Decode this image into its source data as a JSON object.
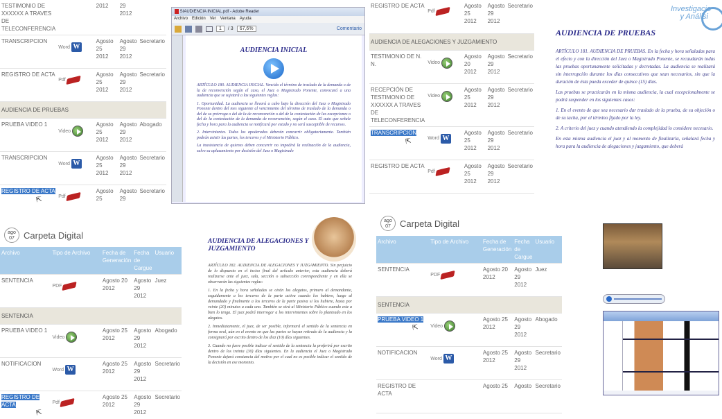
{
  "panel1": {
    "rows": [
      {
        "type": "row",
        "name": "TESTIMONIO DE XXXXXX A TRAVES DE TELECONFERENCIA",
        "file": "",
        "date": "2012",
        "day": "29\n2012",
        "user": ""
      },
      {
        "type": "row",
        "name": "TRANSCRIPCION",
        "file": "Word",
        "date": "Agosto 25\n2012",
        "day": "Agosto\n29\n2012",
        "user": "Secretario"
      },
      {
        "type": "row",
        "name": "REGISTRO DE ACTA",
        "file": "Pdf",
        "date": "Agosto 25\n2012",
        "day": "Agosto\n29\n2012",
        "user": "Secretario"
      },
      {
        "type": "sec",
        "name": "AUDIENCIA DE PRUEBAS"
      },
      {
        "type": "row",
        "name": "PRUEBA VIDEO 1",
        "file": "Video",
        "date": "Agosto 25\n2012",
        "day": "Agosto\n29\n2012",
        "user": "Abogado"
      },
      {
        "type": "row",
        "name": "TRANSCRIPCION",
        "file": "Word",
        "date": "Agosto 25\n2012",
        "day": "Agosto\n29\n2012",
        "user": "Secretario"
      },
      {
        "type": "row",
        "name": "REGISTRO DE ACTA",
        "file": "Pdf",
        "date": "Agosto 25\n2012",
        "day": "Agosto\n29\n2012",
        "user": "Secretario",
        "hl": true
      }
    ]
  },
  "reader": {
    "title": "SIAUDIENCIA INICIAL.pdf - Adobe Reader",
    "menu": [
      "Archivo",
      "Edición",
      "Ver",
      "Ventana",
      "Ayuda"
    ],
    "page": "1",
    "pages": "/ 3",
    "zoom": "67,6%",
    "comment": "Comentario",
    "doc_title": "AUDIENCIA INICIAL",
    "paras": [
      "ARTÍCULO 180. AUDIENCIA INICIAL. Vencido el término de traslado de la demanda o de la de reconvención según el caso, el Juez o Magistrado Ponente, convocará a una audiencia que se sujetará a las siguientes reglas:",
      "1. Oportunidad. La audiencia se llevará a cabo bajo la dirección del Juez o Magistrado Ponente dentro del mes siguiente al vencimiento del término de traslado de la demanda o del de su prórroga o del de la de reconvención o del de la contestación de las excepciones o del de la contestación de la demanda de reconvención, según el caso. El auto que señale fecha y hora para la audiencia se notificará por estado y no será susceptible de recursos.",
      "2. Intervinientes. Todos los apoderados deberán concurrir obligatoriamente. También podrán asistir las partes, los terceros y el Ministerio Público.",
      "La inasistencia de quienes deben concurrir no impedirá la realización de la audiencia, salvo su aplazamiento por decisión del Juez o Magistrado"
    ]
  },
  "panel3": {
    "rows": [
      {
        "type": "row",
        "name": "REGISTRO DE ACTA",
        "file": "Pdf",
        "date": "Agosto 25\n2012",
        "day": "Agosto\n29\n2012",
        "user": "Secretario"
      },
      {
        "type": "sec",
        "name": "AUDIENCIA DE ALEGACIONES Y JUZGAMIENTO"
      },
      {
        "type": "row",
        "name": "TESTIMONIO DE N.\nN.",
        "file": "Video",
        "date": "Agosto 20\n2012",
        "day": "Agosto\n29\n2012",
        "user": "Secretario"
      },
      {
        "type": "row",
        "name": "RECEPCIÓN DE TESTIMONIO DE XXXXXX A TRAVES DE TELECONFERENCIA",
        "file": "Video",
        "date": "Agosto 25\n2012",
        "day": "Agosto\n29\n2012",
        "user": "Secretario"
      },
      {
        "type": "row",
        "name": "TRANSCRIPCION",
        "file": "Word",
        "date": "Agosto 25\n2012",
        "day": "Agosto\n29\n2012",
        "user": "Secretario",
        "hl": true
      },
      {
        "type": "row",
        "name": "REGISTRO DE ACTA",
        "file": "Pdf",
        "date": "Agosto 25\n2012",
        "day": "Agosto\n29\n2012",
        "user": "Secretario"
      }
    ]
  },
  "doc_pruebas": {
    "badge": "Investigacio y Análisi",
    "title": "AUDIENCIA DE PRUEBAS",
    "paras": [
      "ARTÍCULO 181. AUDIENCIA DE PRUEBAS. En la fecha y hora señaladas para el efecto y con la dirección del Juez o Magistrado Ponente, se recaudarán todas las pruebas oportunamente solicitadas y decretadas. La audiencia se realizará sin interrupción durante los días consecutivos que sean necesarios, sin que la duración de ésta pueda exceder de quince (15) días.",
      "Las pruebas se practicarán en la misma audiencia, la cual excepcionalmente se podrá suspender en los siguientes casos:",
      "1. En el evento de que sea necesario dar traslado de la prueba, de su objeción o de su tacha, por el término fijado por la ley.",
      "2. A criterio del juez y cuando atendiendo la complejidad lo considere necesario.",
      "En esta misma audiencia el juez y al momento de finalizarla, señalará fecha y hora para la audiencia de alegaciones y juzgamiento, que deberá"
    ]
  },
  "carpeta1": {
    "cal_month": "ago",
    "cal_day": "07",
    "title": "Carpeta Digital",
    "headers": [
      "Archivo",
      "Tipo de Archivo",
      "Fecha de Generación",
      "Fecha de Cargue",
      "Usuario"
    ],
    "rows": [
      {
        "type": "row",
        "name": "SENTENCIA",
        "file": "PDF",
        "date": "Agosto 20\n2012",
        "day": "Agosto\n29\n2012",
        "user": "Juez"
      },
      {
        "type": "sec",
        "name": "SENTENCIA"
      },
      {
        "type": "row",
        "name": "PRUEBA VIDEO 1",
        "file": "Video",
        "date": "Agosto 25\n2012",
        "day": "Agosto\n29\n2012",
        "user": "Abogado"
      },
      {
        "type": "row",
        "name": "NOTIFICACION",
        "file": "Word",
        "date": "Agosto 25\n2012",
        "day": "Agosto\n29\n2012",
        "user": "Secretario"
      },
      {
        "type": "row",
        "name": "REGISTRO DE ACTA",
        "file": "Pdf",
        "date": "Agosto 25\n2012",
        "day": "Agosto\n29\n2012",
        "user": "Secretario",
        "hl": true
      }
    ]
  },
  "doc_alegaciones": {
    "title": "AUDIENCIA DE ALEGACIONES Y JUZGAMIENTO",
    "paras": [
      "ARTÍCULO 182. AUDIENCIA DE ALEGACIONES Y JUZGAMIENTO. Sin perjuicio de lo dispuesto en el inciso final del artículo anterior, esta audiencia deberá realizarse ante el juez, sala, sección o subsección correspondiente y en ella se observarán las siguientes reglas:",
      "1. En la fecha y hora señaladas se oirán los alegatos, primero al demandante, seguidamente a los terceros de la parte activa cuando los hubiere, luego al demandado y finalmente a los terceros de la parte pasiva si los hubiere, hasta por veinte (20) minutos a cada uno. También se oirá al Ministerio Público cuando este a bien lo tenga. El juez podrá interrogar a los intervinientes sobre lo planteado en los alegatos.",
      "2. Inmediatamente, el juez, de ser posible, informará el sentido de la sentencia en forma oral, aún en el evento en que las partes se hayan retirado de la audiencia y la consignará por escrito dentro de los diez (10) días siguientes.",
      "3. Cuando no fuere posible indicar el sentido de la sentencia la proferirá por escrito dentro de los treinta (30) días siguientes. En la audiencia el Juez o Magistrado Ponente dejará constancia del motivo por el cual no es posible indicar el sentido de la decisión en ese momento."
    ]
  },
  "carpeta2": {
    "cal_month": "ago",
    "cal_day": "07",
    "title": "Carpeta Digital",
    "headers": [
      "Archivo",
      "Tipo de Archivo",
      "Fecha de Generación",
      "Fecha de Cargue",
      "Usuario"
    ],
    "rows": [
      {
        "type": "row",
        "name": "SENTENCIA",
        "file": "PDF",
        "date": "Agosto 20\n2012",
        "day": "Agosto\n29\n2012",
        "user": "Juez"
      },
      {
        "type": "sec",
        "name": "SENTENCIA"
      },
      {
        "type": "row",
        "name": "PRUEBA VIDEO 1",
        "file": "Video",
        "date": "Agosto 25\n2012",
        "day": "Agosto\n29\n2012",
        "user": "Abogado",
        "hl": true
      },
      {
        "type": "row",
        "name": "NOTIFICACION",
        "file": "Word",
        "date": "Agosto 25\n2012",
        "day": "Agosto\n29\n2012",
        "user": "Secretario"
      },
      {
        "type": "row",
        "name": "REGISTRO DE ACTA",
        "file": "",
        "date": "Agosto 25",
        "day": "Agosto",
        "user": "Secretario"
      }
    ]
  },
  "colors": {
    "header": "#a9cdea",
    "section": "#e9e6dc",
    "highlight": "#3a78c8",
    "doc_text": "#3a3a8a",
    "wave": "#cf8a55"
  }
}
